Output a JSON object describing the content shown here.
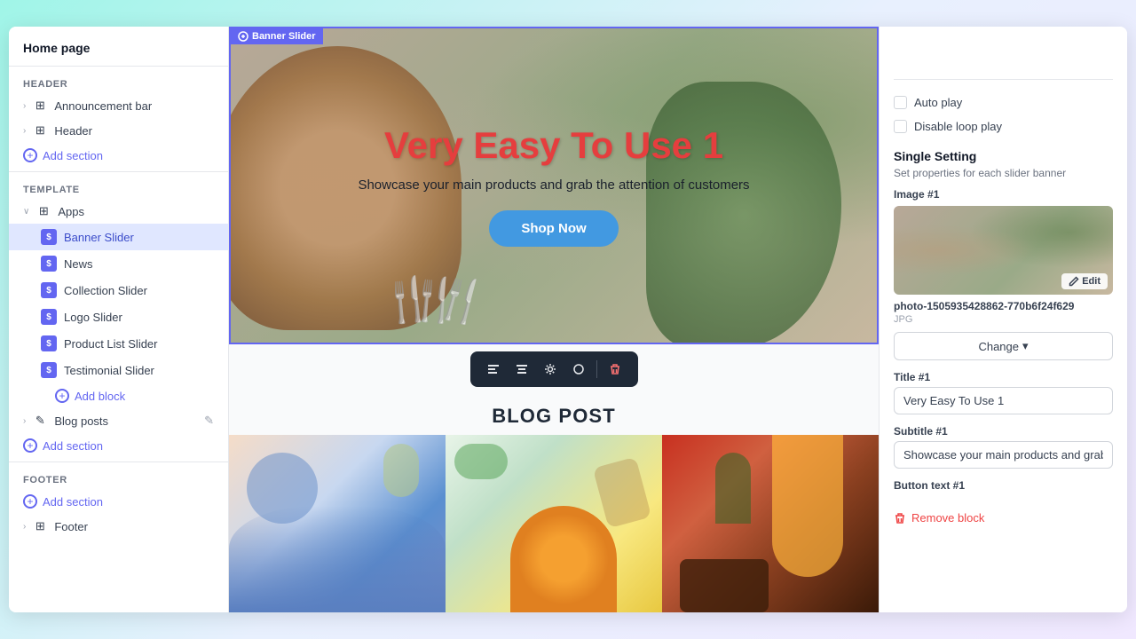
{
  "sidebar": {
    "page_title": "Home page",
    "header_label": "Header",
    "items": {
      "announcement_bar": "Announcement bar",
      "header": "Header",
      "add_section_1": "Add section",
      "template_label": "Template",
      "apps": "Apps",
      "banner_slider": "Banner Slider",
      "news": "News",
      "collection_slider": "Collection Slider",
      "logo_slider": "Logo Slider",
      "product_list_slider": "Product List Slider",
      "testimonial_slider": "Testimonial Slider",
      "add_block": "Add block",
      "blog_posts": "Blog posts",
      "add_section_2": "Add section",
      "footer_label": "Footer",
      "add_section_3": "Add section",
      "footer": "Footer"
    }
  },
  "canvas": {
    "banner_label": "Banner Slider",
    "banner_title": "Very Easy To Use 1",
    "banner_subtitle": "Showcase your main products and grab the attention of customers",
    "shop_now": "Shop Now",
    "blog_title": "BLOG POST",
    "toolbar_icons": [
      "align-left",
      "align-center",
      "move",
      "circle",
      "trash"
    ]
  },
  "right_panel": {
    "auto_play": "Auto play",
    "disable_loop_play": "Disable loop play",
    "single_setting": "Single Setting",
    "single_setting_desc": "Set properties for each slider banner",
    "image_label": "Image #1",
    "filename": "photo-1505935428862-770b6f24f629",
    "file_ext": "JPG",
    "change_btn": "Change",
    "title_label": "Title #1",
    "title_value": "Very Easy To Use 1",
    "subtitle_label": "Subtitle #1",
    "subtitle_value": "Showcase your main products and grab",
    "button_text_label": "Button text #1",
    "remove_block": "Remove block",
    "edit_label": "Edit"
  }
}
